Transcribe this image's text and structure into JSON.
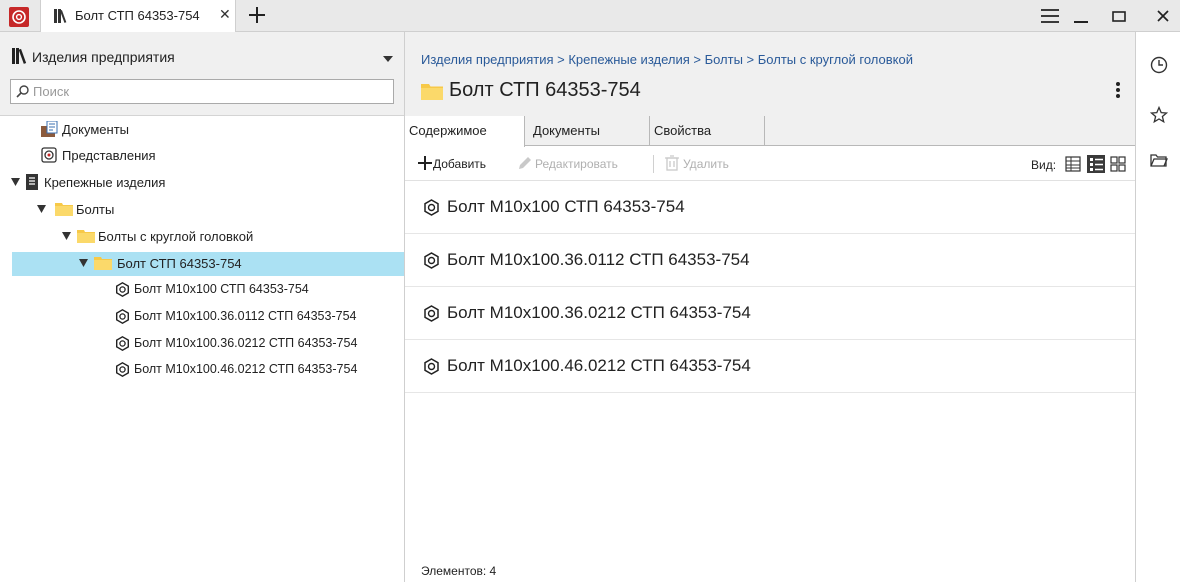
{
  "tab_bar": {
    "tab_title": "Болт СТП 64353-754",
    "close_glyph": "✕",
    "new_tab_icon": "plus-icon",
    "app_icon": "app-logo-icon"
  },
  "library": {
    "title": "Изделия предприятия",
    "search_placeholder": "Поиск",
    "search_value": ""
  },
  "tree": [
    {
      "label": "Документы",
      "icon": "documents-icon"
    },
    {
      "label": "Представления",
      "icon": "views-icon"
    },
    {
      "label": "Крепежные изделия",
      "icon": "catalog-icon",
      "expanded": true
    },
    {
      "label": "Болты",
      "icon": "folder-icon",
      "expanded": true
    },
    {
      "label": "Болты с круглой головкой",
      "icon": "folder-icon",
      "expanded": true
    },
    {
      "label": "Болт СТП 64353-754",
      "icon": "folder-icon",
      "expanded": true,
      "selected": true
    },
    {
      "label": "Болт М10х100 СТП 64353-754",
      "icon": "part-icon"
    },
    {
      "label": "Болт М10х100.36.0112 СТП 64353-754",
      "icon": "part-icon"
    },
    {
      "label": "Болт М10х100.36.0212 СТП 64353-754",
      "icon": "part-icon"
    },
    {
      "label": "Болт М10х100.46.0212 СТП 64353-754",
      "icon": "part-icon"
    }
  ],
  "main": {
    "breadcrumb": "Изделия предприятия > Крепежные изделия > Болты > Болты с круглой головкой",
    "title": "Болт СТП 64353-754",
    "tabs": [
      {
        "label": "Содержимое",
        "active": true
      },
      {
        "label": "Документы",
        "active": false
      },
      {
        "label": "Свойства",
        "active": false
      }
    ],
    "toolbar": {
      "add": "Добавить",
      "edit": "Редактировать",
      "delete": "Удалить",
      "view_label": "Вид:"
    },
    "items": [
      {
        "label": "Болт М10х100 СТП 64353-754"
      },
      {
        "label": "Болт М10х100.36.0112 СТП 64353-754"
      },
      {
        "label": "Болт М10х100.36.0212 СТП 64353-754"
      },
      {
        "label": "Болт М10х100.46.0212 СТП 64353-754"
      }
    ],
    "status": "Элементов: 4"
  },
  "colors": {
    "accent": "#c62828",
    "selection": "#abe1f3",
    "folder": "#f7c948",
    "link": "#2a5a99"
  }
}
